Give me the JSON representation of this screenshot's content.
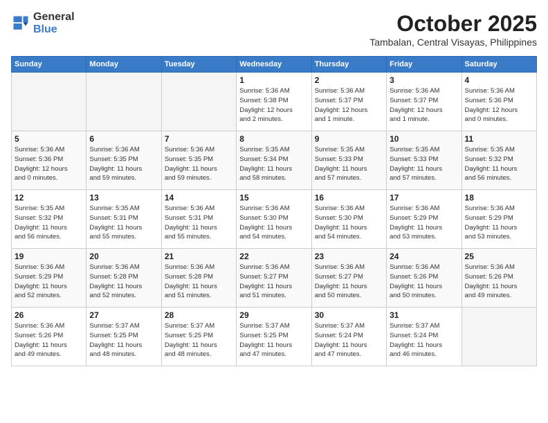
{
  "header": {
    "logo_general": "General",
    "logo_blue": "Blue",
    "month_title": "October 2025",
    "location": "Tambalan, Central Visayas, Philippines"
  },
  "weekdays": [
    "Sunday",
    "Monday",
    "Tuesday",
    "Wednesday",
    "Thursday",
    "Friday",
    "Saturday"
  ],
  "weeks": [
    [
      {
        "day": "",
        "info": ""
      },
      {
        "day": "",
        "info": ""
      },
      {
        "day": "",
        "info": ""
      },
      {
        "day": "1",
        "info": "Sunrise: 5:36 AM\nSunset: 5:38 PM\nDaylight: 12 hours\nand 2 minutes."
      },
      {
        "day": "2",
        "info": "Sunrise: 5:36 AM\nSunset: 5:37 PM\nDaylight: 12 hours\nand 1 minute."
      },
      {
        "day": "3",
        "info": "Sunrise: 5:36 AM\nSunset: 5:37 PM\nDaylight: 12 hours\nand 1 minute."
      },
      {
        "day": "4",
        "info": "Sunrise: 5:36 AM\nSunset: 5:36 PM\nDaylight: 12 hours\nand 0 minutes."
      }
    ],
    [
      {
        "day": "5",
        "info": "Sunrise: 5:36 AM\nSunset: 5:36 PM\nDaylight: 12 hours\nand 0 minutes."
      },
      {
        "day": "6",
        "info": "Sunrise: 5:36 AM\nSunset: 5:35 PM\nDaylight: 11 hours\nand 59 minutes."
      },
      {
        "day": "7",
        "info": "Sunrise: 5:36 AM\nSunset: 5:35 PM\nDaylight: 11 hours\nand 59 minutes."
      },
      {
        "day": "8",
        "info": "Sunrise: 5:35 AM\nSunset: 5:34 PM\nDaylight: 11 hours\nand 58 minutes."
      },
      {
        "day": "9",
        "info": "Sunrise: 5:35 AM\nSunset: 5:33 PM\nDaylight: 11 hours\nand 57 minutes."
      },
      {
        "day": "10",
        "info": "Sunrise: 5:35 AM\nSunset: 5:33 PM\nDaylight: 11 hours\nand 57 minutes."
      },
      {
        "day": "11",
        "info": "Sunrise: 5:35 AM\nSunset: 5:32 PM\nDaylight: 11 hours\nand 56 minutes."
      }
    ],
    [
      {
        "day": "12",
        "info": "Sunrise: 5:35 AM\nSunset: 5:32 PM\nDaylight: 11 hours\nand 56 minutes."
      },
      {
        "day": "13",
        "info": "Sunrise: 5:35 AM\nSunset: 5:31 PM\nDaylight: 11 hours\nand 55 minutes."
      },
      {
        "day": "14",
        "info": "Sunrise: 5:36 AM\nSunset: 5:31 PM\nDaylight: 11 hours\nand 55 minutes."
      },
      {
        "day": "15",
        "info": "Sunrise: 5:36 AM\nSunset: 5:30 PM\nDaylight: 11 hours\nand 54 minutes."
      },
      {
        "day": "16",
        "info": "Sunrise: 5:36 AM\nSunset: 5:30 PM\nDaylight: 11 hours\nand 54 minutes."
      },
      {
        "day": "17",
        "info": "Sunrise: 5:36 AM\nSunset: 5:29 PM\nDaylight: 11 hours\nand 53 minutes."
      },
      {
        "day": "18",
        "info": "Sunrise: 5:36 AM\nSunset: 5:29 PM\nDaylight: 11 hours\nand 53 minutes."
      }
    ],
    [
      {
        "day": "19",
        "info": "Sunrise: 5:36 AM\nSunset: 5:29 PM\nDaylight: 11 hours\nand 52 minutes."
      },
      {
        "day": "20",
        "info": "Sunrise: 5:36 AM\nSunset: 5:28 PM\nDaylight: 11 hours\nand 52 minutes."
      },
      {
        "day": "21",
        "info": "Sunrise: 5:36 AM\nSunset: 5:28 PM\nDaylight: 11 hours\nand 51 minutes."
      },
      {
        "day": "22",
        "info": "Sunrise: 5:36 AM\nSunset: 5:27 PM\nDaylight: 11 hours\nand 51 minutes."
      },
      {
        "day": "23",
        "info": "Sunrise: 5:36 AM\nSunset: 5:27 PM\nDaylight: 11 hours\nand 50 minutes."
      },
      {
        "day": "24",
        "info": "Sunrise: 5:36 AM\nSunset: 5:26 PM\nDaylight: 11 hours\nand 50 minutes."
      },
      {
        "day": "25",
        "info": "Sunrise: 5:36 AM\nSunset: 5:26 PM\nDaylight: 11 hours\nand 49 minutes."
      }
    ],
    [
      {
        "day": "26",
        "info": "Sunrise: 5:36 AM\nSunset: 5:26 PM\nDaylight: 11 hours\nand 49 minutes."
      },
      {
        "day": "27",
        "info": "Sunrise: 5:37 AM\nSunset: 5:25 PM\nDaylight: 11 hours\nand 48 minutes."
      },
      {
        "day": "28",
        "info": "Sunrise: 5:37 AM\nSunset: 5:25 PM\nDaylight: 11 hours\nand 48 minutes."
      },
      {
        "day": "29",
        "info": "Sunrise: 5:37 AM\nSunset: 5:25 PM\nDaylight: 11 hours\nand 47 minutes."
      },
      {
        "day": "30",
        "info": "Sunrise: 5:37 AM\nSunset: 5:24 PM\nDaylight: 11 hours\nand 47 minutes."
      },
      {
        "day": "31",
        "info": "Sunrise: 5:37 AM\nSunset: 5:24 PM\nDaylight: 11 hours\nand 46 minutes."
      },
      {
        "day": "",
        "info": ""
      }
    ]
  ]
}
